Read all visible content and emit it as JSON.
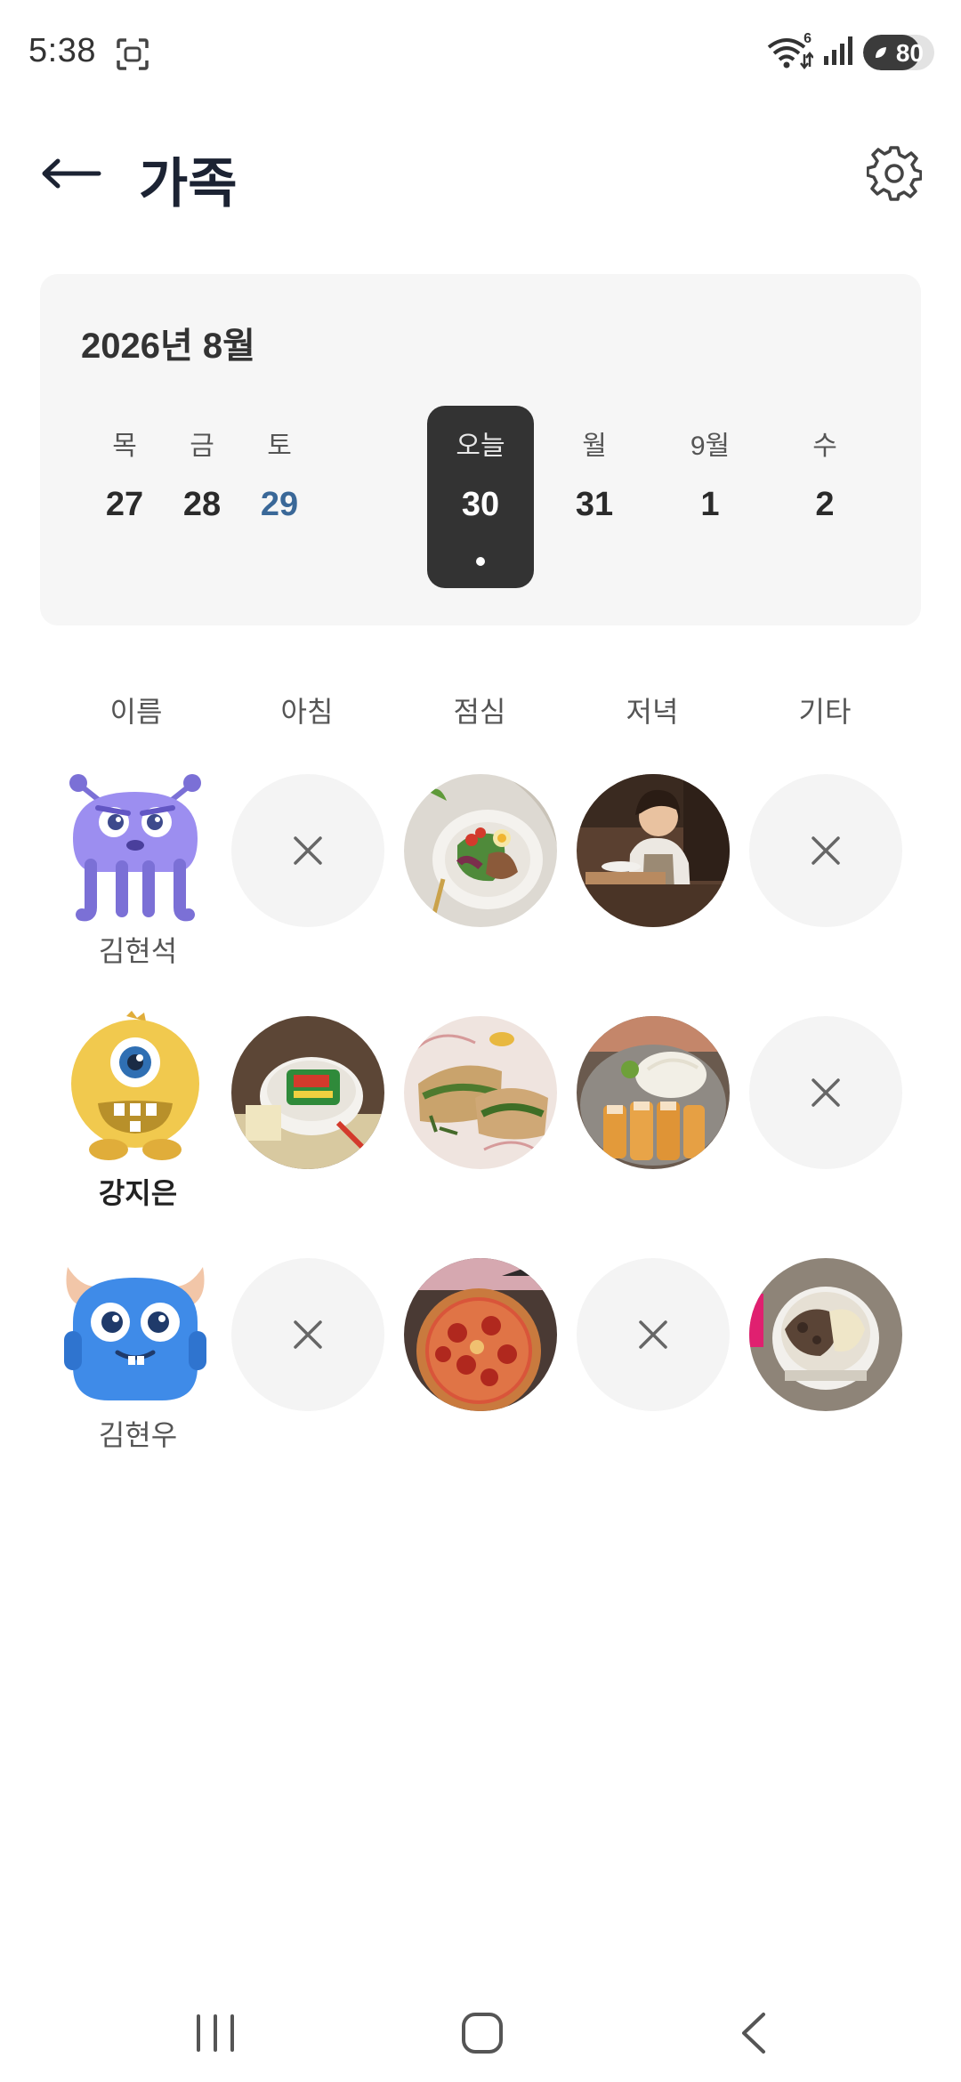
{
  "status": {
    "time": "5:38",
    "battery_level": 80,
    "battery_label": "80",
    "wifi_badge": "6",
    "icons": [
      "screenshot-icon",
      "wifi-icon",
      "signal-icon",
      "battery-icon"
    ]
  },
  "header": {
    "title": "가족",
    "back_icon": "arrow-left-icon",
    "settings_icon": "gear-icon"
  },
  "calendar": {
    "month_label": "2026년 8월",
    "days": [
      {
        "name": "목",
        "num": "27",
        "state": "normal"
      },
      {
        "name": "금",
        "num": "28",
        "state": "normal"
      },
      {
        "name": "토",
        "num": "29",
        "state": "saturday"
      },
      {
        "name": "오늘",
        "num": "30",
        "state": "selected"
      },
      {
        "name": "월",
        "num": "31",
        "state": "normal"
      },
      {
        "name": "9월",
        "num": "1",
        "state": "normal"
      },
      {
        "name": "수",
        "num": "2",
        "state": "normal"
      }
    ]
  },
  "table": {
    "headers": [
      "이름",
      "아침",
      "점심",
      "저녁",
      "기타"
    ],
    "members": [
      {
        "name": "김현석",
        "avatar": "purple-monster-avatar",
        "bold": false,
        "meals": [
          "empty",
          "salad-bowl-photo",
          "cafe-server-photo",
          "empty"
        ]
      },
      {
        "name": "강지은",
        "avatar": "yellow-monster-avatar",
        "bold": true,
        "meals": [
          "ramen-cup-photo",
          "sandwich-photo",
          "tonkatsu-photo",
          "empty"
        ]
      },
      {
        "name": "김현우",
        "avatar": "blue-monster-avatar",
        "bold": false,
        "meals": [
          "empty",
          "pizza-photo",
          "empty",
          "dessert-cup-photo"
        ]
      }
    ]
  },
  "nav": {
    "icons": [
      "recent-apps-icon",
      "home-icon",
      "back-nav-icon"
    ]
  },
  "colors": {
    "title": "#1c2333",
    "selected_day_bg": "#333333",
    "saturday": "#3a6898",
    "card_bg": "#f6f6f6",
    "empty_meal_bg": "#f4f4f4"
  }
}
